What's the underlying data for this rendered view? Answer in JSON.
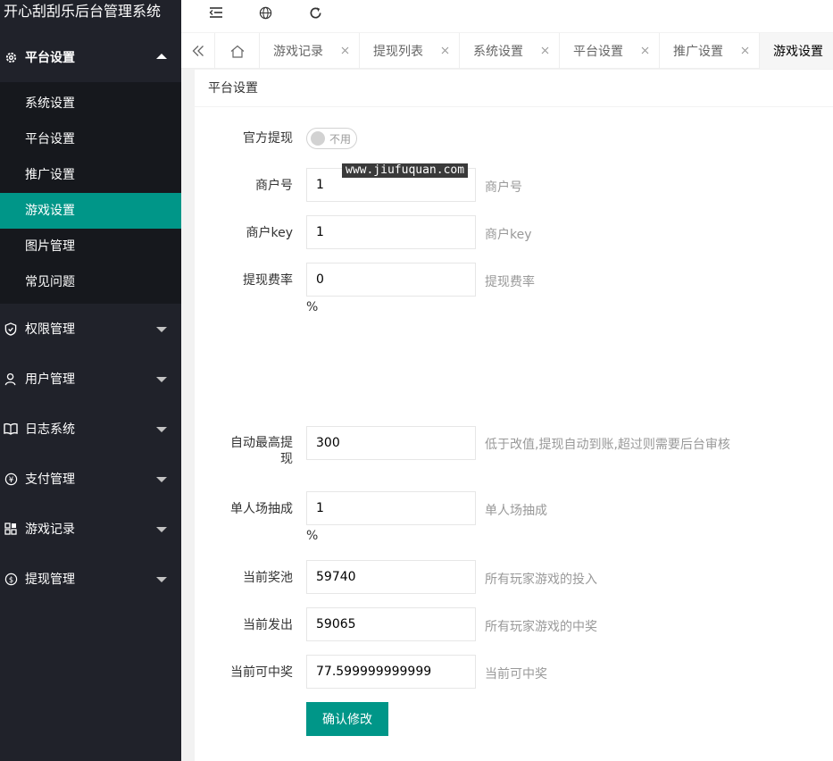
{
  "app": {
    "title": "开心刮刮乐后台管理系统"
  },
  "sidebar": {
    "groups": [
      {
        "label": "平台设置",
        "icon": "gear-icon",
        "open": true,
        "items": [
          {
            "label": "系统设置",
            "active": false
          },
          {
            "label": "平台设置",
            "active": false
          },
          {
            "label": "推广设置",
            "active": false
          },
          {
            "label": "游戏设置",
            "active": true
          },
          {
            "label": "图片管理",
            "active": false
          },
          {
            "label": "常见问题",
            "active": false
          }
        ]
      },
      {
        "label": "权限管理",
        "icon": "shield-icon"
      },
      {
        "label": "用户管理",
        "icon": "user-icon"
      },
      {
        "label": "日志系统",
        "icon": "book-icon"
      },
      {
        "label": "支付管理",
        "icon": "yen-icon"
      },
      {
        "label": "游戏记录",
        "icon": "apps-icon"
      },
      {
        "label": "提现管理",
        "icon": "dollar-icon"
      }
    ]
  },
  "header": {
    "icons": [
      "menu-fold-icon",
      "globe-icon",
      "refresh-icon"
    ]
  },
  "tabs": [
    {
      "label": "游戏记录",
      "active": false
    },
    {
      "label": "提现列表",
      "active": false
    },
    {
      "label": "系统设置",
      "active": false
    },
    {
      "label": "平台设置",
      "active": false
    },
    {
      "label": "推广设置",
      "active": false
    },
    {
      "label": "游戏设置",
      "active": true
    }
  ],
  "card": {
    "title": "平台设置",
    "form": {
      "official_withdraw": {
        "label": "官方提现",
        "switch_text": "不用",
        "on": false
      },
      "merchant_id": {
        "label": "商户号",
        "value": "1",
        "aux": "商户号"
      },
      "merchant_key": {
        "label": "商户key",
        "value": "1",
        "aux": "商户key"
      },
      "withdraw_fee": {
        "label": "提现费率",
        "value": "0",
        "aux": "提现费率",
        "unit": "%"
      },
      "auto_max_withdraw": {
        "label_line1": "自动最高提",
        "label_line2": "现",
        "value": "300",
        "aux": "低于改值,提现自动到账,超过则需要后台审核"
      },
      "single_round_cut": {
        "label": "单人场抽成",
        "value": "1",
        "aux": "单人场抽成",
        "unit": "%"
      },
      "current_pool": {
        "label": "当前奖池",
        "value": "59740",
        "aux": "所有玩家游戏的投入"
      },
      "current_payout": {
        "label": "当前发出",
        "value": "59065",
        "aux": "所有玩家游戏的中奖"
      },
      "current_winnable": {
        "label": "当前可中奖",
        "value": "77.599999999999",
        "aux": "当前可中奖"
      },
      "submit_label": "确认修改"
    }
  },
  "watermark": "www.jiufuquan.com",
  "colors": {
    "sidebar_bg": "#20222a",
    "submenu_bg": "#16181d",
    "accent": "#009688"
  }
}
